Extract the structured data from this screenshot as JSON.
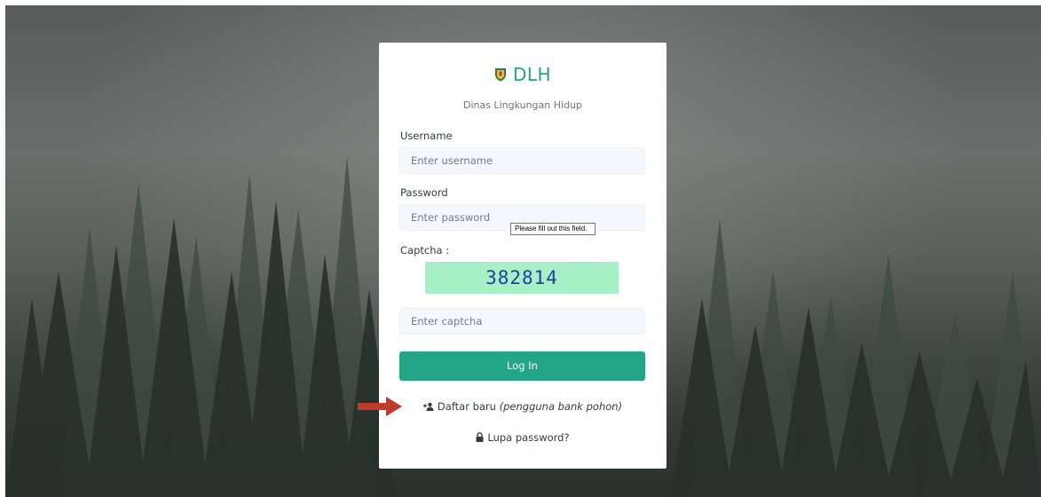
{
  "brand": {
    "name": "DLH",
    "subtitle": "Dinas Lingkungan Hidup",
    "logo": "shield-emblem-icon"
  },
  "form": {
    "username_label": "Username",
    "username_placeholder": "Enter username",
    "password_label": "Password",
    "password_placeholder": "Enter password",
    "captcha_label": "Captcha :",
    "captcha_code": "382814",
    "captcha_placeholder": "Enter captcha",
    "login_label": "Log In"
  },
  "links": {
    "register_text": "Daftar baru",
    "register_note": "(pengguna bank pohon)",
    "register_icon": "user-plus-icon",
    "forgot_text": "Lupa password?",
    "forgot_icon": "lock-icon"
  },
  "tooltip": {
    "text": "Please fill out this field."
  },
  "colors": {
    "accent": "#23a687",
    "captcha_bg": "#a6f0c6",
    "captcha_text": "#1f3f9d",
    "arrow": "#c0392b"
  }
}
